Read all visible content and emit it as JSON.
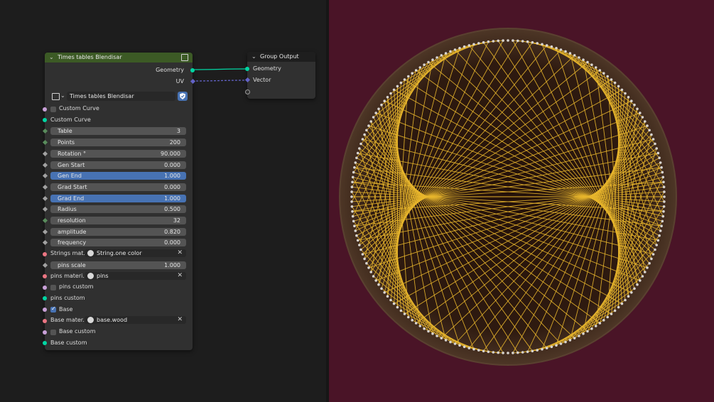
{
  "node_main": {
    "title": "Times tables Blendisar",
    "outputs": [
      {
        "label": "Geometry",
        "color": "#00d6a3"
      },
      {
        "label": "UV",
        "color": "#6363c7"
      }
    ],
    "group_selector": "Times tables Blendisar",
    "header_color": "#3c5a25",
    "rows": [
      {
        "type": "checkbox",
        "label": "Custom Curve",
        "checked": false,
        "socket": "#c9a0d8"
      },
      {
        "type": "label",
        "label": "Custom Curve",
        "socket": "#00d6a3"
      },
      {
        "type": "slider",
        "label": "Table",
        "value": "3",
        "highlight": false,
        "socket": "#598c5c"
      },
      {
        "type": "slider",
        "label": "Points",
        "value": "200",
        "highlight": false,
        "socket": "#598c5c"
      },
      {
        "type": "slider",
        "label": "Rotation °",
        "value": "90.000",
        "highlight": false,
        "socket": "#a1a1a1"
      },
      {
        "type": "slider",
        "label": "Gen Start",
        "value": "0.000",
        "highlight": false,
        "socket": "#a1a1a1"
      },
      {
        "type": "slider",
        "label": "Gen End",
        "value": "1.000",
        "highlight": true,
        "socket": "#a1a1a1"
      },
      {
        "type": "slider",
        "label": "Grad Start",
        "value": "0.000",
        "highlight": false,
        "socket": "#a1a1a1"
      },
      {
        "type": "slider",
        "label": "Grad End",
        "value": "1.000",
        "highlight": true,
        "socket": "#a1a1a1"
      },
      {
        "type": "slider",
        "label": "Radius",
        "value": "0.500",
        "highlight": false,
        "socket": "#a1a1a1"
      },
      {
        "type": "slider",
        "label": "resolution",
        "value": "32",
        "highlight": false,
        "socket": "#598c5c"
      },
      {
        "type": "slider",
        "label": "amplitude",
        "value": "0.820",
        "highlight": false,
        "socket": "#a1a1a1"
      },
      {
        "type": "slider",
        "label": "frequency",
        "value": "0.000",
        "highlight": false,
        "socket": "#a1a1a1"
      },
      {
        "type": "material",
        "label": "Strings mat...",
        "value": "String.one color",
        "socket": "#eb7582"
      },
      {
        "type": "slider",
        "label": "pins scale",
        "value": "1.000",
        "highlight": false,
        "socket": "#a1a1a1"
      },
      {
        "type": "material",
        "label": "pins materi...",
        "value": "pins",
        "socket": "#eb7582"
      },
      {
        "type": "checkbox",
        "label": "pins custom",
        "checked": false,
        "socket": "#c9a0d8"
      },
      {
        "type": "label",
        "label": "pins custom",
        "socket": "#00d6a3"
      },
      {
        "type": "checkbox",
        "label": "Base",
        "checked": true,
        "socket": "#c9a0d8"
      },
      {
        "type": "material",
        "label": "Base mater...",
        "value": "base.wood",
        "socket": "#eb7582"
      },
      {
        "type": "checkbox",
        "label": "Base custom",
        "checked": false,
        "socket": "#c9a0d8"
      },
      {
        "type": "label",
        "label": "Base custom",
        "socket": "#00d6a3"
      }
    ]
  },
  "node_output": {
    "title": "Group Output",
    "inputs": [
      {
        "label": "Geometry",
        "color": "#00d6a3"
      },
      {
        "label": "Vector",
        "color": "#6363c7"
      }
    ]
  },
  "viewport": {
    "background": "#4a1427",
    "board_color": "#3a2418",
    "string_color": "#e8b62c",
    "pin_color": "#d8d4d0",
    "table": 3,
    "points": 200,
    "rotation_deg": 90
  },
  "icons": [
    "chevron-down-icon",
    "node-group-icon",
    "fake-user-shield-icon",
    "material-globe-icon",
    "clear-x-icon",
    "checkmark-icon"
  ]
}
